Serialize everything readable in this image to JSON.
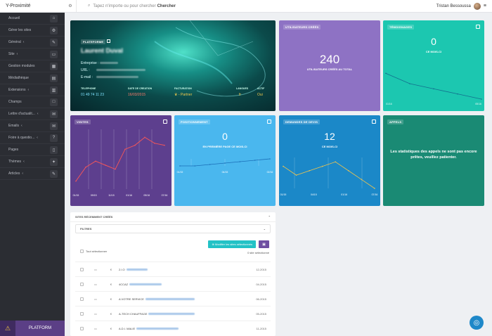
{
  "topbar": {
    "brand": "Y-Proximité",
    "gear_icon": "gear-icon",
    "search_prefix": "Tapez n'importe ou pour chercher",
    "search_bold": "Chercher",
    "user_name": "Tristan Bessoussa"
  },
  "sidebar": {
    "items": [
      {
        "label": "Accueil",
        "icon": "home-icon",
        "glyph": "⌂",
        "arrow": ""
      },
      {
        "label": "Gérer les sites",
        "icon": "gear-icon",
        "glyph": "⚙",
        "arrow": ""
      },
      {
        "label": "Général",
        "icon": "wrench-icon",
        "glyph": "✎",
        "arrow": "‹"
      },
      {
        "label": "Site",
        "icon": "monitor-icon",
        "glyph": "▭",
        "arrow": "‹"
      },
      {
        "label": "Gestion modules",
        "icon": "grid-icon",
        "glyph": "▦",
        "arrow": ""
      },
      {
        "label": "Médiathèque",
        "icon": "file-icon",
        "glyph": "▤",
        "arrow": ""
      },
      {
        "label": "Extensions",
        "icon": "table-icon",
        "glyph": "▥",
        "arrow": "‹"
      },
      {
        "label": "Champs",
        "icon": "square-icon",
        "glyph": "□",
        "arrow": ""
      },
      {
        "label": "Lettre d'actualit...",
        "icon": "mail-icon",
        "glyph": "✉",
        "arrow": "‹"
      },
      {
        "label": "Emails",
        "icon": "envelope-icon",
        "glyph": "✉",
        "arrow": "‹"
      },
      {
        "label": "Foire à questio...",
        "icon": "question-icon",
        "glyph": "?",
        "arrow": "‹"
      },
      {
        "label": "Pages",
        "icon": "page-icon",
        "glyph": "▯",
        "arrow": ""
      },
      {
        "label": "Thèmes",
        "icon": "brush-icon",
        "glyph": "✦",
        "arrow": "‹"
      },
      {
        "label": "Articles",
        "icon": "pencil-icon",
        "glyph": "✎",
        "arrow": "‹"
      }
    ],
    "footer": "PLATFORM"
  },
  "hero": {
    "tag": "PLATEFORME",
    "name": "Laurent Duval",
    "entreprise_label": "Entreprise :",
    "url_label": "URL :",
    "email_label": "E-mail :",
    "tel_label": "TELEPHONE",
    "tel": "01 49 74 11 23",
    "date_label": "DATE DE CREATION",
    "date": "16/03/2015",
    "fact_label": "FACTURATION",
    "fact": "- Partner",
    "lang_label": "LANGUES",
    "lang": "fr",
    "actif_label": "ACTIF",
    "actif": "Oui"
  },
  "users": {
    "title": "UTILISATEURS CRÉÉS",
    "value": "240",
    "caption": "UTILISATEURS CRÉÉS AU TOTAL",
    "color": "#8e72c4"
  },
  "temoignages": {
    "title": "TÉMOIGNAGES",
    "value": "0",
    "caption": "CE MOIS-CI",
    "x_start": "01/16",
    "x_end": "05/16",
    "color": "#1cc7b0"
  },
  "visites": {
    "title": "VISITES",
    "ticks": [
      "01/15",
      "09/15",
      "11/15",
      "01/16",
      "05/16",
      "07/16"
    ],
    "color": "#5d3f8e"
  },
  "positionnement": {
    "title": "POSITIONNEMENT",
    "value": "0",
    "caption": "EN PREMIÈRE PAGE CE MOIS-CI",
    "ticks": [
      "01/15",
      "04/15",
      "02/16"
    ],
    "color": "#4ab7ee"
  },
  "devis": {
    "title": "DEMANDES DE DEVIS",
    "value": "12",
    "caption": "CE MOIS-CI",
    "ticks": [
      "01/15",
      "04/15",
      "01/16",
      "07/16"
    ],
    "color": "#1b88c8"
  },
  "appels": {
    "title": "APPELS",
    "message": "Les statistiques des appels ne sont pas encore prêtes, veuillez patienter.",
    "color": "#1a8a74"
  },
  "chart_data": [
    {
      "type": "line",
      "title": "VISITES",
      "x": [
        "01/15",
        "09/15",
        "11/15",
        "01/16",
        "05/16",
        "07/16"
      ],
      "series": [
        {
          "values": [
            8,
            22,
            28,
            24,
            20,
            40,
            44,
            52,
            46,
            44
          ]
        }
      ]
    },
    {
      "type": "line",
      "title": "POSITIONNEMENT",
      "x": [
        "01/15",
        "04/15",
        "02/16"
      ],
      "series": [
        {
          "values": [
            0,
            0,
            0.2,
            0.4,
            0.6,
            0.8,
            1
          ]
        }
      ]
    },
    {
      "type": "line",
      "title": "DEMANDES DE DEVIS",
      "x": [
        "01/15",
        "04/15",
        "01/16",
        "07/16"
      ],
      "series": [
        {
          "values": [
            10,
            6,
            8,
            10,
            12,
            8,
            4,
            0
          ]
        }
      ]
    },
    {
      "type": "line",
      "title": "TÉMOIGNAGES",
      "x": [
        "01/16",
        "05/16"
      ],
      "series": [
        {
          "values": [
            5,
            3,
            2,
            1,
            0
          ]
        }
      ]
    }
  ],
  "sites": {
    "title": "SITES RÉCEMMENT CRÉÉS",
    "filters": "FILTRES",
    "modify_btn": "Modifier les sites sélectionnés",
    "select_all": "Tout sélectionner",
    "selected": "0 site sélectionné",
    "rows": [
      {
        "prefix": "2.I.O",
        "date": "12-2015",
        "w": 30
      },
      {
        "prefix": "4CCAZ",
        "date": "04-2015",
        "w": 46
      },
      {
        "prefix": "A VOTRE SERVICE",
        "date": "06-2015",
        "w": 70
      },
      {
        "prefix": "A-TECH CHAUFFAGE",
        "date": "05-2015",
        "w": 66
      },
      {
        "prefix": "A.D.I. MALIE",
        "date": "11-2015",
        "w": 60
      }
    ]
  }
}
